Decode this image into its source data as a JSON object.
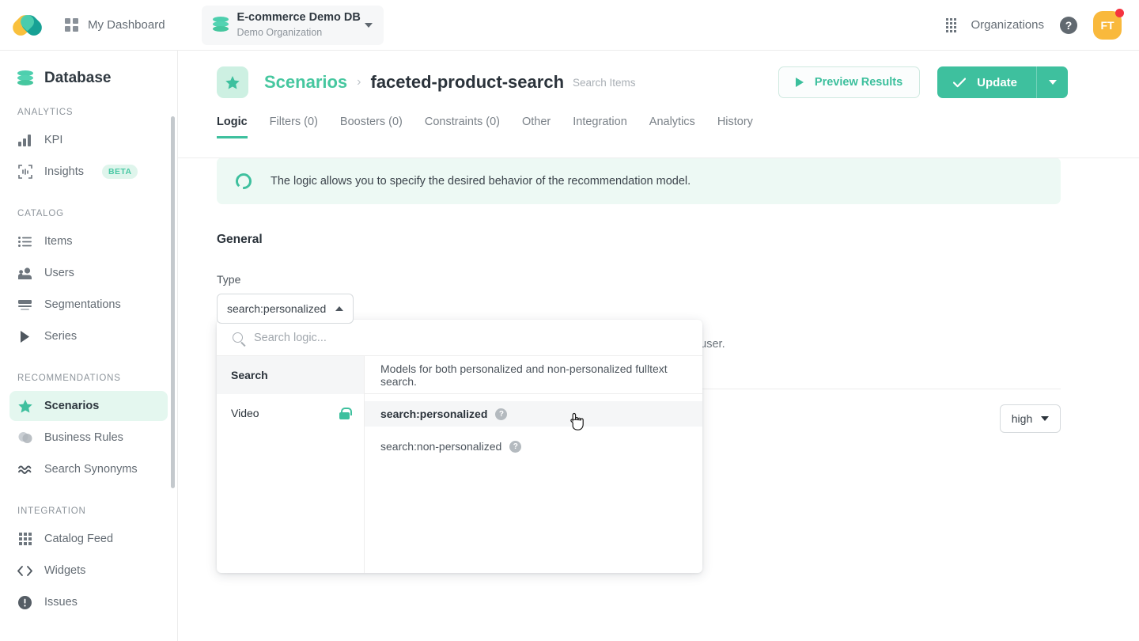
{
  "topbar": {
    "logo": "app-logo",
    "dashboard_label": "My Dashboard",
    "org": {
      "name": "E-commerce Demo DB",
      "subtitle": "Demo Organization"
    },
    "organizations_label": "Organizations",
    "help_label": "?",
    "avatar_initials": "FT"
  },
  "sidebar": {
    "title": "Database",
    "groups": [
      {
        "label": "ANALYTICS",
        "items": [
          {
            "label": "KPI",
            "icon": "bar-chart-icon",
            "active": false,
            "badge": ""
          },
          {
            "label": "Insights",
            "icon": "insights-icon",
            "active": false,
            "badge": "BETA"
          }
        ]
      },
      {
        "label": "CATALOG",
        "items": [
          {
            "label": "Items",
            "icon": "list-icon",
            "active": false,
            "badge": ""
          },
          {
            "label": "Users",
            "icon": "users-icon",
            "active": false,
            "badge": ""
          },
          {
            "label": "Segmentations",
            "icon": "segmentations-icon",
            "active": false,
            "badge": ""
          },
          {
            "label": "Series",
            "icon": "play-triangle-icon",
            "active": false,
            "badge": ""
          }
        ]
      },
      {
        "label": "RECOMMENDATIONS",
        "items": [
          {
            "label": "Scenarios",
            "icon": "star-icon",
            "active": true,
            "badge": ""
          },
          {
            "label": "Business Rules",
            "icon": "business-rules-icon",
            "active": false,
            "badge": ""
          },
          {
            "label": "Search Synonyms",
            "icon": "synonyms-icon",
            "active": false,
            "badge": ""
          }
        ]
      },
      {
        "label": "INTEGRATION",
        "items": [
          {
            "label": "Catalog Feed",
            "icon": "grid-dots-icon",
            "active": false,
            "badge": ""
          },
          {
            "label": "Widgets",
            "icon": "code-brackets-icon",
            "active": false,
            "badge": ""
          },
          {
            "label": "Issues",
            "icon": "exclamation-circle-icon",
            "active": false,
            "badge": ""
          }
        ]
      }
    ]
  },
  "page": {
    "breadcrumb_root": "Scenarios",
    "breadcrumb_sep": "›",
    "title": "faceted-product-search",
    "kind": "Search Items",
    "preview_button": "Preview Results",
    "update_button": "Update"
  },
  "tabs": [
    {
      "label": "Logic",
      "active": true
    },
    {
      "label": "Filters (0)",
      "active": false
    },
    {
      "label": "Boosters (0)",
      "active": false
    },
    {
      "label": "Constraints (0)",
      "active": false
    },
    {
      "label": "Other",
      "active": false
    },
    {
      "label": "Integration",
      "active": false
    },
    {
      "label": "Analytics",
      "active": false
    },
    {
      "label": "History",
      "active": false
    }
  ],
  "banner": {
    "text": "The logic allows you to specify the desired behavior of the recommendation model."
  },
  "general": {
    "section_title": "General",
    "type_label": "Type",
    "type_value": "search:personalized"
  },
  "background": {
    "description_tail": "l preferences of the user.",
    "priority_value": "high"
  },
  "dropdown": {
    "search_placeholder": "Search logic...",
    "categories": [
      {
        "label": "Search",
        "selected": true,
        "locked": false
      },
      {
        "label": "Video",
        "selected": false,
        "locked": true
      }
    ],
    "category_description": "Models for both personalized and non-personalized fulltext search.",
    "options": [
      {
        "label": "search:personalized",
        "highlighted": true,
        "help": "?"
      },
      {
        "label": "search:non-personalized",
        "highlighted": false,
        "help": "?"
      }
    ]
  },
  "colors": {
    "accent_green": "#3ec09e",
    "accent_green_light": "#e4f7ef",
    "avatar_orange": "#f9b93c",
    "notification_red": "#f5333f",
    "text_dark": "#2b333b",
    "text_muted": "#7a8188"
  }
}
